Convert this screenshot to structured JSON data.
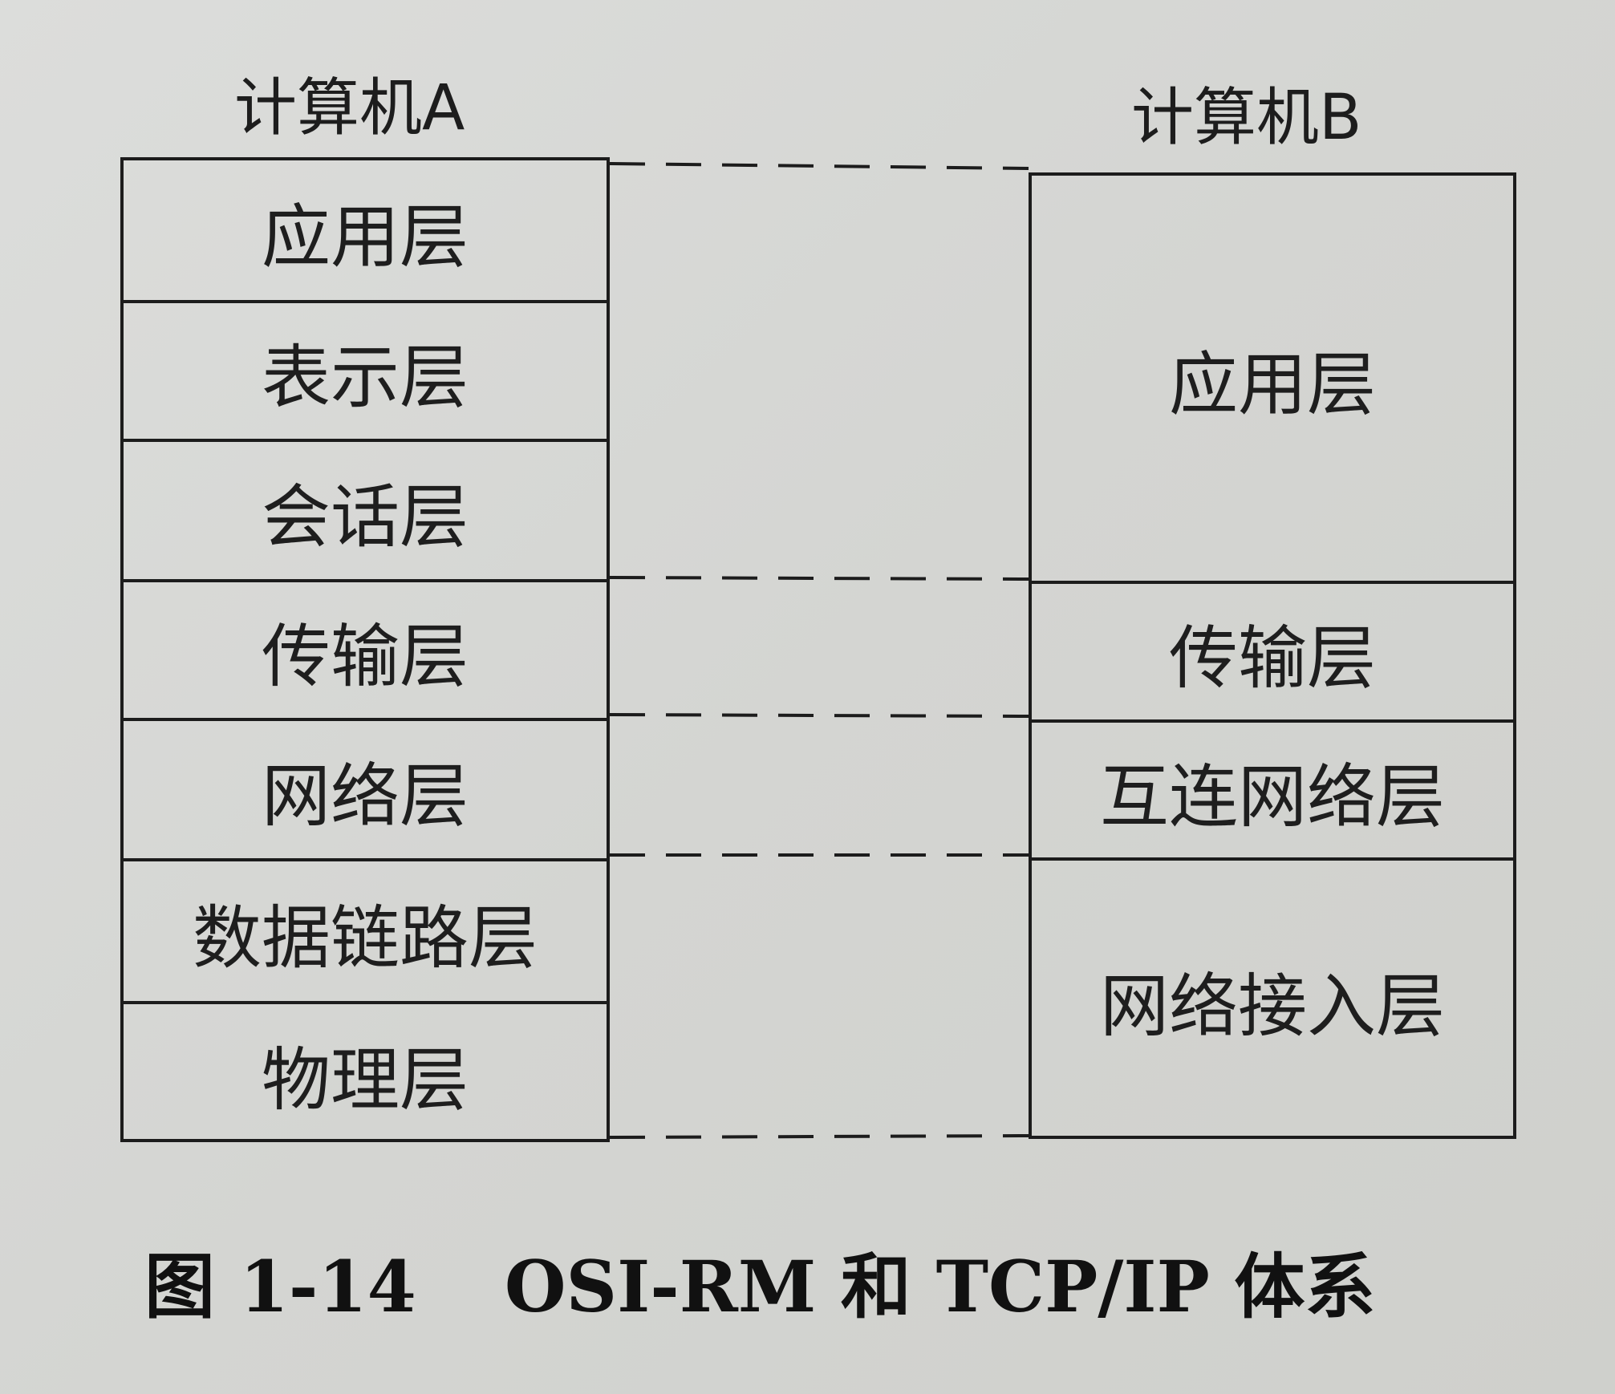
{
  "computer_a": {
    "title": "计算机A",
    "layers": [
      "应用层",
      "表示层",
      "会话层",
      "传输层",
      "网络层",
      "数据链路层",
      "物理层"
    ]
  },
  "computer_b": {
    "title": "计算机B",
    "layers": [
      "应用层",
      "传输层",
      "互连网络层",
      "网络接入层"
    ]
  },
  "caption": {
    "number": "图 1-14",
    "text": "OSI-RM 和 TCP/IP 体系"
  },
  "colors": {
    "line": "#1c1c1c",
    "text": "#1e1e1e",
    "paper": "#d6d7d4"
  }
}
